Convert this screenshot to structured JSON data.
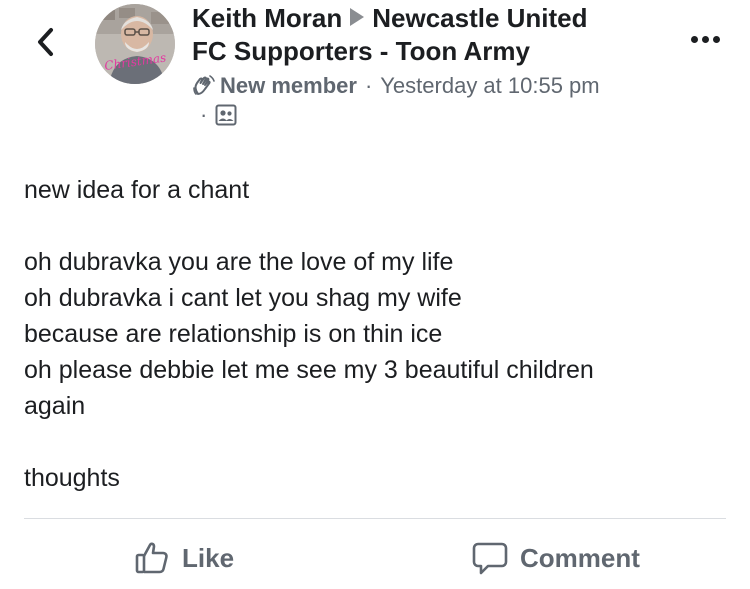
{
  "post": {
    "author": "Keith Moran",
    "group": "Newcastle United FC Supporters - Toon Army",
    "group_line1": "Newcastle United",
    "group_line2": "FC Supporters - Toon Army",
    "badge": "New member",
    "separator": "·",
    "timestamp": "Yesterday at 10:55 pm",
    "audience_icon": "group-audience-icon",
    "avatar_sticker_text": "Christmas",
    "body": {
      "line1": "new idea for a chant",
      "line2": "oh dubravka you are the love of my life",
      "line3": "oh dubravka i cant let you shag my wife",
      "line4": "because are relationship is on thin ice",
      "line5": "oh please debbie let me see my 3 beautiful children",
      "line6": "again",
      "line7": "thoughts"
    }
  },
  "actions": {
    "like_label": "Like",
    "comment_label": "Comment"
  },
  "colors": {
    "text_primary": "#1c1e21",
    "text_secondary": "#606770",
    "divider": "#dadde1"
  },
  "icons": {
    "back": "chevron-left-icon",
    "more": "more-horizontal-icon",
    "like": "thumbs-up-icon",
    "comment": "comment-bubble-icon",
    "badge": "waving-hand-icon"
  }
}
